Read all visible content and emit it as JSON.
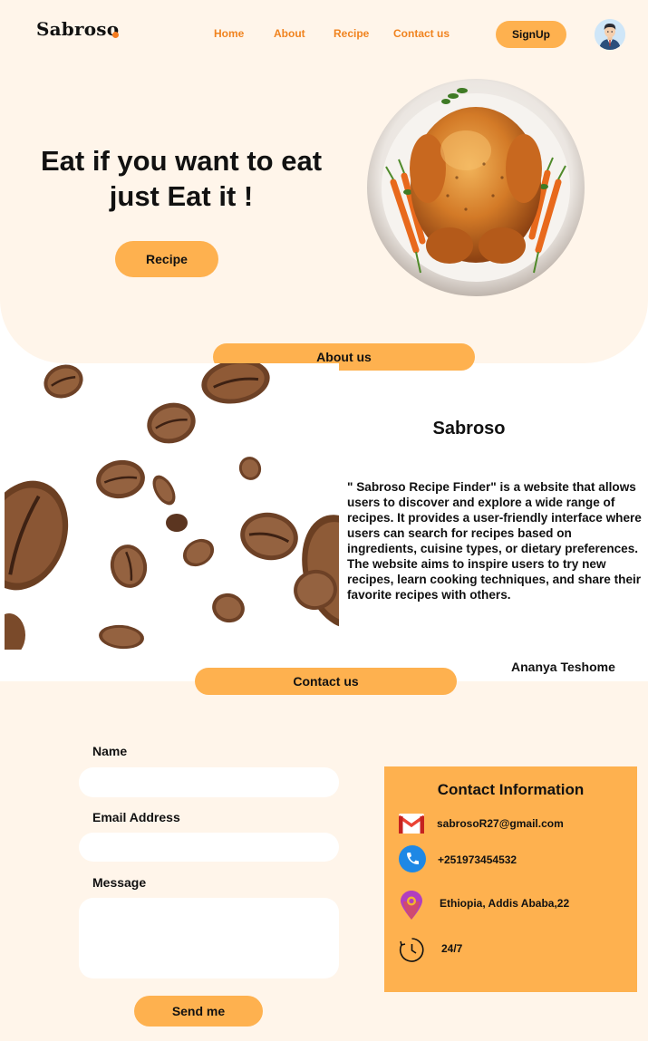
{
  "brand": {
    "name": "Sabroso"
  },
  "nav": {
    "home": "Home",
    "about": "About",
    "recipe": "Recipe",
    "contact": "Contact us",
    "signup": "SignUp"
  },
  "hero": {
    "title_line1": "Eat if you want to eat",
    "title_line2": "just Eat it !",
    "button": "Recipe"
  },
  "about": {
    "pill": "About us",
    "title": "Sabroso",
    "text": " \" Sabroso Recipe Finder\" is a website that allows users to discover and explore a wide range of recipes. It provides a user-friendly interface where users can search for recipes based on ingredients, cuisine types, or dietary preferences. The website aims to inspire users to try new recipes, learn cooking techniques, and share their favorite recipes with others.",
    "author": "Ananya Teshome"
  },
  "contact": {
    "pill": "Contact us",
    "name_label": "Name",
    "email_label": "Email Address",
    "message_label": "Message",
    "name_value": "",
    "email_value": "",
    "message_value": "",
    "send": "Send me",
    "info_title": "Contact Information",
    "email": "sabrosoR27@gmail.com",
    "phone": "+251973454532",
    "address": "Ethiopia, Addis Ababa,22",
    "hours": "24/7"
  },
  "icons": {
    "avatar": "user-avatar",
    "mail": "gmail-icon",
    "phone": "phone-icon",
    "location": "location-pin-icon",
    "clock": "clock-icon"
  },
  "colors": {
    "accent": "#feb14f",
    "nav_text": "#f0831f",
    "cream": "#fff5ea",
    "dot": "#f57c1f"
  }
}
